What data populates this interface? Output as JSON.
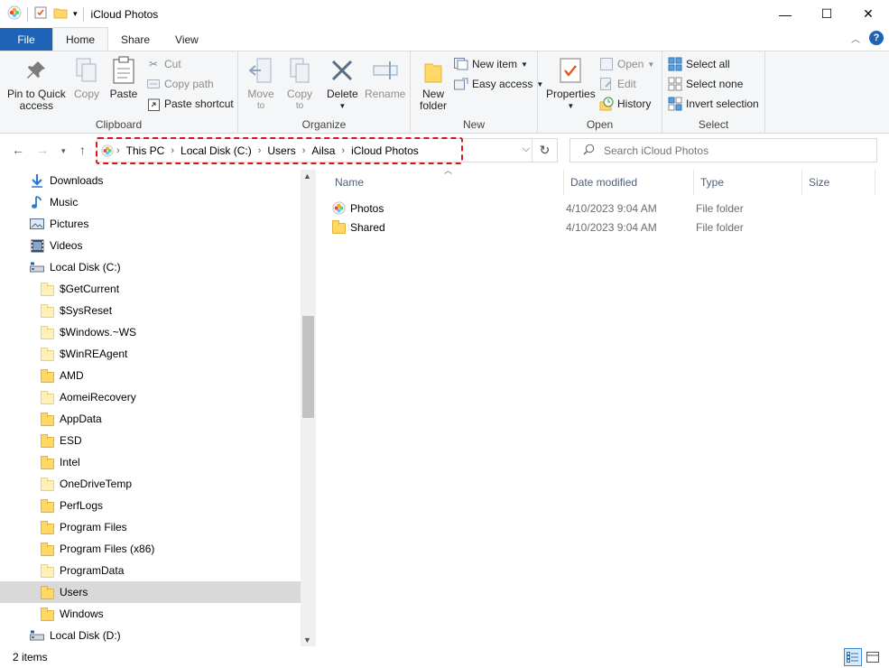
{
  "window": {
    "title": "iCloud Photos",
    "minimize": "—",
    "maximize": "☐",
    "close": "✕"
  },
  "ribbon_tabs": [
    "File",
    "Home",
    "Share",
    "View"
  ],
  "ribbon": {
    "clipboard": {
      "label": "Clipboard",
      "pin_line1": "Pin to Quick",
      "pin_line2": "access",
      "copy": "Copy",
      "paste": "Paste",
      "cut": "Cut",
      "copy_path": "Copy path",
      "paste_shortcut": "Paste shortcut"
    },
    "organize": {
      "label": "Organize",
      "move_to_1": "Move",
      "move_to_2": "to",
      "copy_to_1": "Copy",
      "copy_to_2": "to",
      "delete": "Delete",
      "rename": "Rename"
    },
    "new": {
      "label": "New",
      "new_folder_1": "New",
      "new_folder_2": "folder",
      "new_item": "New item",
      "easy_access": "Easy access"
    },
    "open": {
      "label": "Open",
      "properties": "Properties",
      "open": "Open",
      "edit": "Edit",
      "history": "History"
    },
    "select": {
      "label": "Select",
      "select_all": "Select all",
      "select_none": "Select none",
      "invert_selection": "Invert selection"
    }
  },
  "address": {
    "crumbs": [
      "This PC",
      "Local Disk (C:)",
      "Users",
      "Ailsa",
      "iCloud Photos"
    ],
    "search_placeholder": "Search iCloud Photos"
  },
  "nav_tree": [
    {
      "label": "Downloads",
      "icon": "download-icon",
      "indent": 0
    },
    {
      "label": "Music",
      "icon": "music-icon",
      "indent": 0
    },
    {
      "label": "Pictures",
      "icon": "pictures-icon",
      "indent": 0
    },
    {
      "label": "Videos",
      "icon": "videos-icon",
      "indent": 0
    },
    {
      "label": "Local Disk (C:)",
      "icon": "drive-icon",
      "indent": 0
    },
    {
      "label": "$GetCurrent",
      "icon": "folder-icon",
      "indent": 1,
      "pale": true
    },
    {
      "label": "$SysReset",
      "icon": "folder-icon",
      "indent": 1,
      "pale": true
    },
    {
      "label": "$Windows.~WS",
      "icon": "folder-icon",
      "indent": 1,
      "pale": true
    },
    {
      "label": "$WinREAgent",
      "icon": "folder-icon",
      "indent": 1,
      "pale": true
    },
    {
      "label": "AMD",
      "icon": "folder-icon",
      "indent": 1
    },
    {
      "label": "AomeiRecovery",
      "icon": "folder-icon",
      "indent": 1,
      "pale": true
    },
    {
      "label": "AppData",
      "icon": "folder-icon",
      "indent": 1
    },
    {
      "label": "ESD",
      "icon": "folder-icon",
      "indent": 1
    },
    {
      "label": "Intel",
      "icon": "folder-icon",
      "indent": 1
    },
    {
      "label": "OneDriveTemp",
      "icon": "folder-icon",
      "indent": 1,
      "pale": true
    },
    {
      "label": "PerfLogs",
      "icon": "folder-icon",
      "indent": 1
    },
    {
      "label": "Program Files",
      "icon": "folder-icon",
      "indent": 1
    },
    {
      "label": "Program Files (x86)",
      "icon": "folder-icon",
      "indent": 1
    },
    {
      "label": "ProgramData",
      "icon": "folder-icon",
      "indent": 1,
      "pale": true
    },
    {
      "label": "Users",
      "icon": "folder-icon",
      "indent": 1,
      "selected": true
    },
    {
      "label": "Windows",
      "icon": "folder-icon",
      "indent": 1
    },
    {
      "label": "Local Disk (D:)",
      "icon": "drive-icon",
      "indent": 0
    }
  ],
  "columns": [
    "Name",
    "Date modified",
    "Type",
    "Size"
  ],
  "files": [
    {
      "name": "Photos",
      "date": "4/10/2023 9:04 AM",
      "type": "File folder",
      "icon": "icloud-photos-icon"
    },
    {
      "name": "Shared",
      "date": "4/10/2023 9:04 AM",
      "type": "File folder",
      "icon": "folder-icon"
    }
  ],
  "status": {
    "item_count": "2 items"
  },
  "colors": {
    "accent": "#1e63b6",
    "highlight_dash": "#d7141a",
    "folder": "#ffd866"
  }
}
